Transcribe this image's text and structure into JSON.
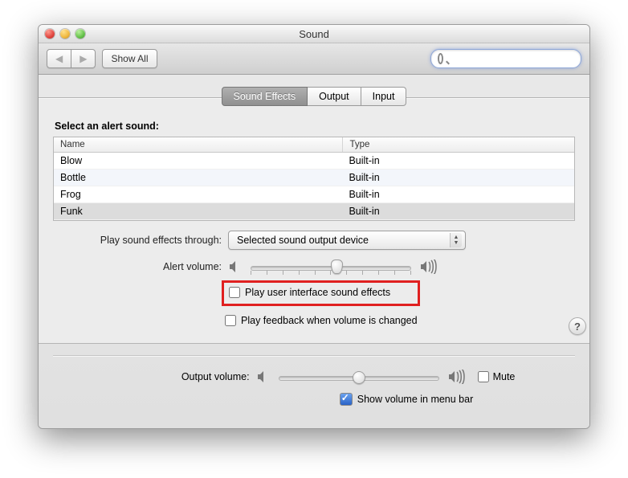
{
  "window": {
    "title": "Sound"
  },
  "toolbar": {
    "showall": "Show All",
    "search_placeholder": ""
  },
  "tabs": {
    "effects": "Sound Effects",
    "output": "Output",
    "input": "Input"
  },
  "section": {
    "select_label": "Select an alert sound:"
  },
  "table": {
    "cols": {
      "name": "Name",
      "type": "Type"
    },
    "rows": [
      {
        "name": "Blow",
        "type": "Built-in"
      },
      {
        "name": "Bottle",
        "type": "Built-in"
      },
      {
        "name": "Frog",
        "type": "Built-in"
      },
      {
        "name": "Funk",
        "type": "Built-in"
      }
    ]
  },
  "play_through": {
    "label": "Play sound effects through:",
    "value": "Selected sound output device"
  },
  "alert_volume": {
    "label": "Alert volume:"
  },
  "checkboxes": {
    "ui_effects": "Play user interface sound effects",
    "feedback": "Play feedback when volume is changed"
  },
  "output_volume": {
    "label": "Output volume:",
    "mute": "Mute"
  },
  "show_menu": "Show volume in menu bar",
  "help": "?"
}
